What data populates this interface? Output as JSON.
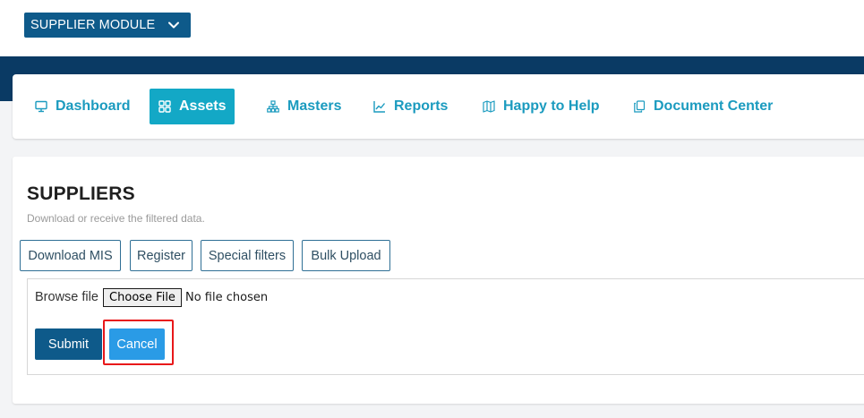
{
  "module_selector": {
    "label": "SUPPLIER MODULE",
    "icon": "chevron-down-icon"
  },
  "nav": {
    "items": [
      {
        "label": "Dashboard",
        "icon": "monitor-icon",
        "active": false
      },
      {
        "label": "Assets",
        "icon": "grid-icon",
        "active": true
      },
      {
        "label": "Masters",
        "icon": "hierarchy-icon",
        "active": false
      },
      {
        "label": "Reports",
        "icon": "line-chart-icon",
        "active": false
      },
      {
        "label": "Happy to Help",
        "icon": "map-icon",
        "active": false
      },
      {
        "label": "Document Center",
        "icon": "documents-icon",
        "active": false
      }
    ]
  },
  "page": {
    "title": "SUPPLIERS",
    "subtitle": "Download or receive the filtered data."
  },
  "actions": {
    "download_mis": "Download MIS",
    "register": "Register",
    "special_filters": "Special filters",
    "bulk_upload": "Bulk Upload"
  },
  "upload": {
    "browse_label": "Browse file",
    "choose_file": "Choose File",
    "no_file": "No file chosen",
    "submit": "Submit",
    "cancel": "Cancel"
  },
  "colors": {
    "brand_dark": "#0a3a64",
    "module_blue": "#0e5a8a",
    "accent_teal": "#13a8c6",
    "cancel_blue": "#2a9be6",
    "highlight_red": "#e8181a"
  }
}
